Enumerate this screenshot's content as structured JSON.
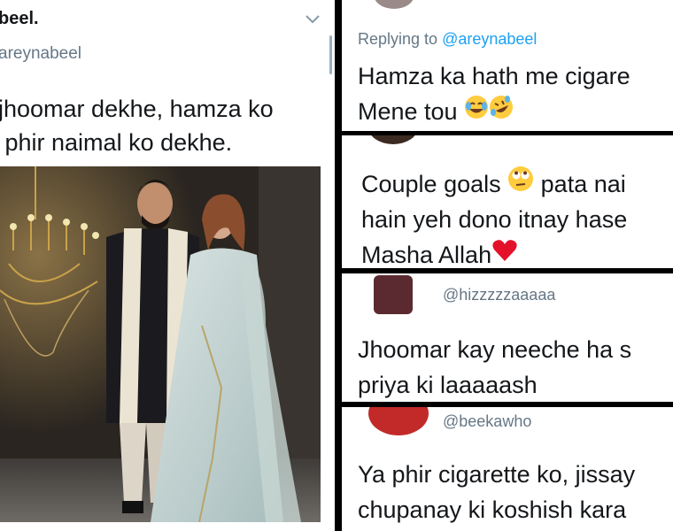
{
  "left_tweet": {
    "name": "beel.",
    "handle": "areynabeel",
    "text_line1": "jhoomar dekhe, hamza ko",
    "text_line2": " phir naimal ko dekhe.",
    "chevron": "chevron-down-icon"
  },
  "replies": [
    {
      "replying_prefix": "Replying to ",
      "replying_handle": "@areynabeel",
      "line1": "Hamza ka hath me cigare",
      "line2": "Mene tou",
      "emoji": [
        "face-with-tears-of-joy",
        "rolling-on-the-floor-laughing"
      ]
    },
    {
      "line1": "Couple goals",
      "line1_tail": "pata nai",
      "line2": "hain yeh dono itnay hase",
      "line3": "Masha Allah",
      "emoji": [
        "face-with-rolling-eyes",
        "red-heart"
      ]
    },
    {
      "handle": "@hizzzzzaaaaa",
      "line1": "Jhoomar kay neeche ha s",
      "line2": "priya ki laaaaash"
    },
    {
      "handle": "@beekawho",
      "line1": "Ya phir cigarette ko, jissay",
      "line2": "chupanay ki koshish kara"
    }
  ],
  "colors": {
    "link": "#1da1f2",
    "muted": "#657786",
    "text": "#14171a",
    "divider": "#000000"
  }
}
